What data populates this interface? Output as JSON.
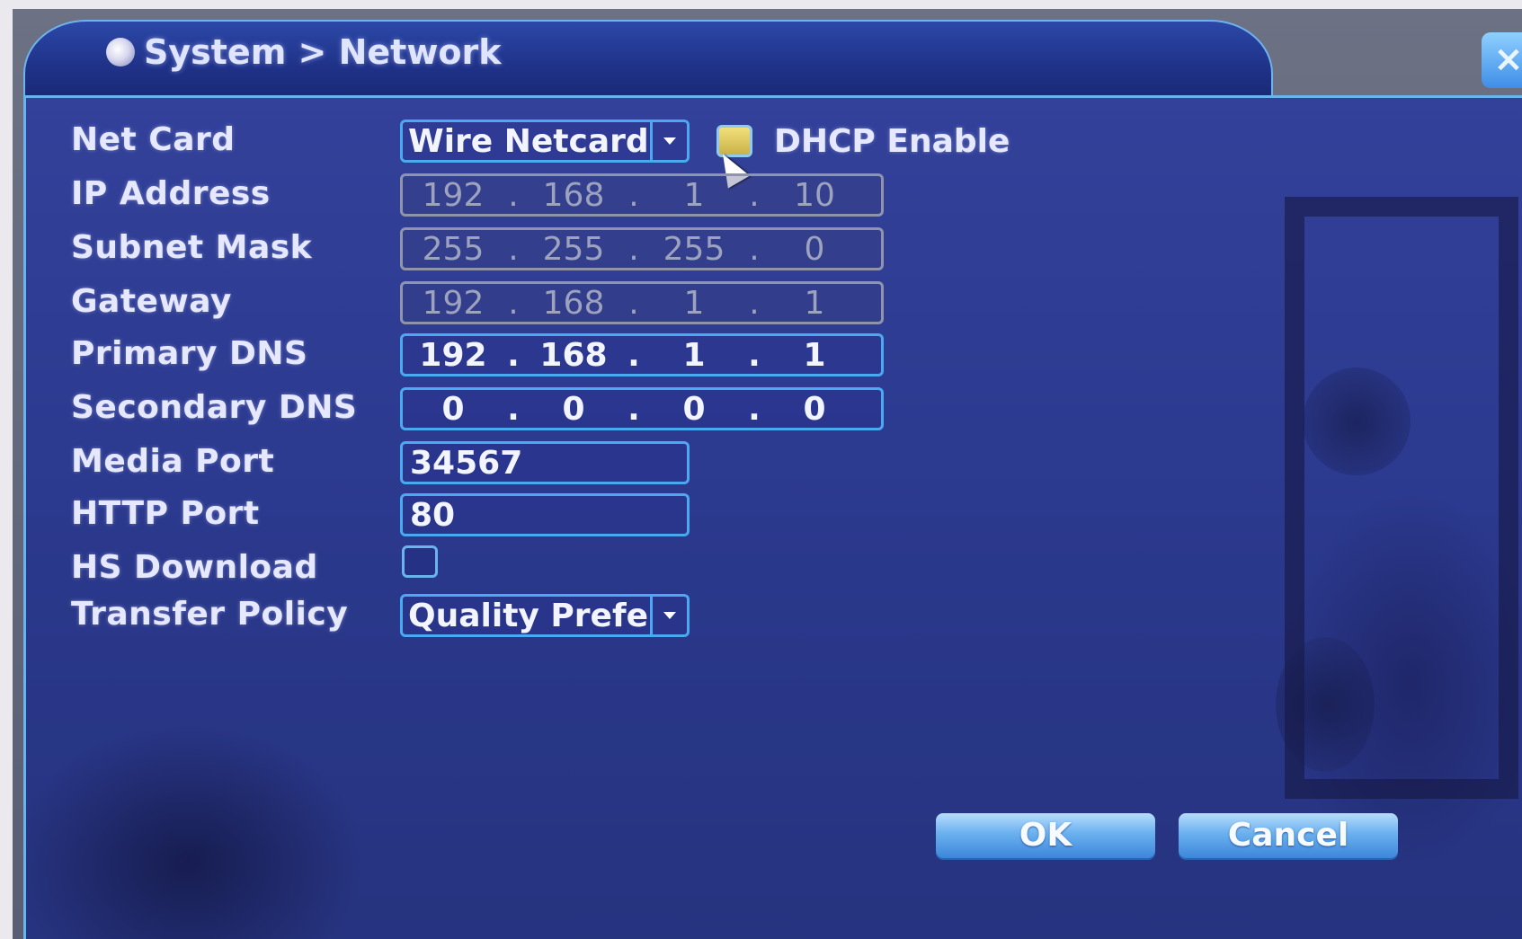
{
  "window": {
    "title": "System > Network",
    "close_symbol": "×"
  },
  "form": {
    "net_card": {
      "label": "Net Card",
      "value": "Wire Netcard"
    },
    "dhcp": {
      "label": "DHCP Enable",
      "checked": true
    },
    "ip_address": {
      "label": "IP Address",
      "octets": [
        "192",
        "168",
        "1",
        "10"
      ],
      "enabled": false
    },
    "subnet_mask": {
      "label": "Subnet Mask",
      "octets": [
        "255",
        "255",
        "255",
        "0"
      ],
      "enabled": false
    },
    "gateway": {
      "label": "Gateway",
      "octets": [
        "192",
        "168",
        "1",
        "1"
      ],
      "enabled": false
    },
    "primary_dns": {
      "label": "Primary DNS",
      "octets": [
        "192",
        "168",
        "1",
        "1"
      ],
      "enabled": true
    },
    "secondary_dns": {
      "label": "Secondary DNS",
      "octets": [
        "0",
        "0",
        "0",
        "0"
      ],
      "enabled": true
    },
    "media_port": {
      "label": "Media Port",
      "value": "34567"
    },
    "http_port": {
      "label": "HTTP Port",
      "value": "80"
    },
    "hs_download": {
      "label": "HS Download",
      "checked": false
    },
    "transfer_policy": {
      "label": "Transfer Policy",
      "value": "Quality Prefe"
    }
  },
  "buttons": {
    "ok": "OK",
    "cancel": "Cancel"
  },
  "colors": {
    "panel_bg": "#2c3a90",
    "field_border": "#4aa9f0",
    "checkbox_checked": "#e6d26a"
  }
}
